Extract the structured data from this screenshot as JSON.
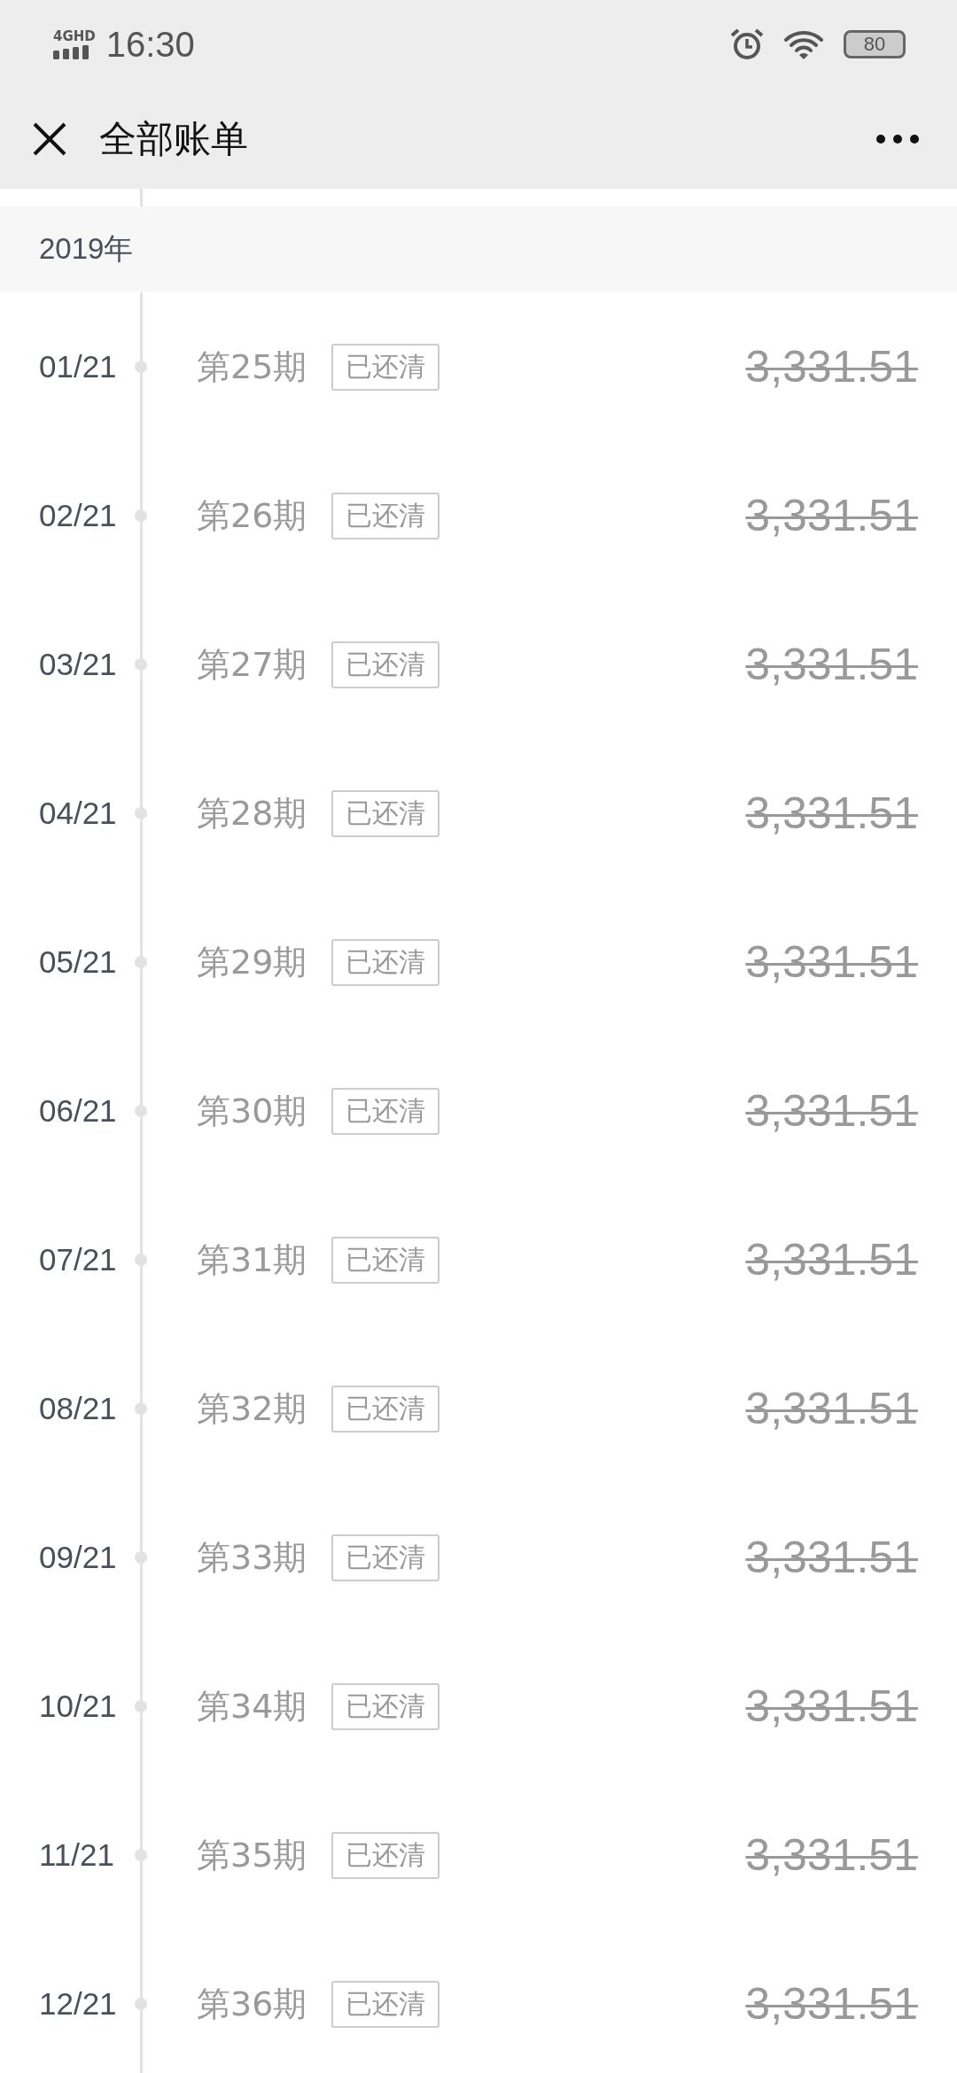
{
  "status_bar": {
    "network": "4GHD",
    "time": "16:30",
    "battery": "80"
  },
  "header": {
    "title": "全部账单"
  },
  "year": "2019年",
  "bills": [
    {
      "date": "01/21",
      "period": "第25期",
      "status": "已还清",
      "paid": true,
      "amount": "3,331.51"
    },
    {
      "date": "02/21",
      "period": "第26期",
      "status": "已还清",
      "paid": true,
      "amount": "3,331.51"
    },
    {
      "date": "03/21",
      "period": "第27期",
      "status": "已还清",
      "paid": true,
      "amount": "3,331.51"
    },
    {
      "date": "04/21",
      "period": "第28期",
      "status": "已还清",
      "paid": true,
      "amount": "3,331.51"
    },
    {
      "date": "05/21",
      "period": "第29期",
      "status": "已还清",
      "paid": true,
      "amount": "3,331.51"
    },
    {
      "date": "06/21",
      "period": "第30期",
      "status": "已还清",
      "paid": true,
      "amount": "3,331.51"
    },
    {
      "date": "07/21",
      "period": "第31期",
      "status": "已还清",
      "paid": true,
      "amount": "3,331.51"
    },
    {
      "date": "08/21",
      "period": "第32期",
      "status": "已还清",
      "paid": true,
      "amount": "3,331.51"
    },
    {
      "date": "09/21",
      "period": "第33期",
      "status": "已还清",
      "paid": true,
      "amount": "3,331.51"
    },
    {
      "date": "10/21",
      "period": "第34期",
      "status": "已还清",
      "paid": true,
      "amount": "3,331.51"
    },
    {
      "date": "11/21",
      "period": "第35期",
      "status": "已还清",
      "paid": true,
      "amount": "3,331.51"
    },
    {
      "date": "12/21",
      "period": "第36期",
      "status": "已还清",
      "paid": true,
      "amount": "3,331.51"
    }
  ]
}
